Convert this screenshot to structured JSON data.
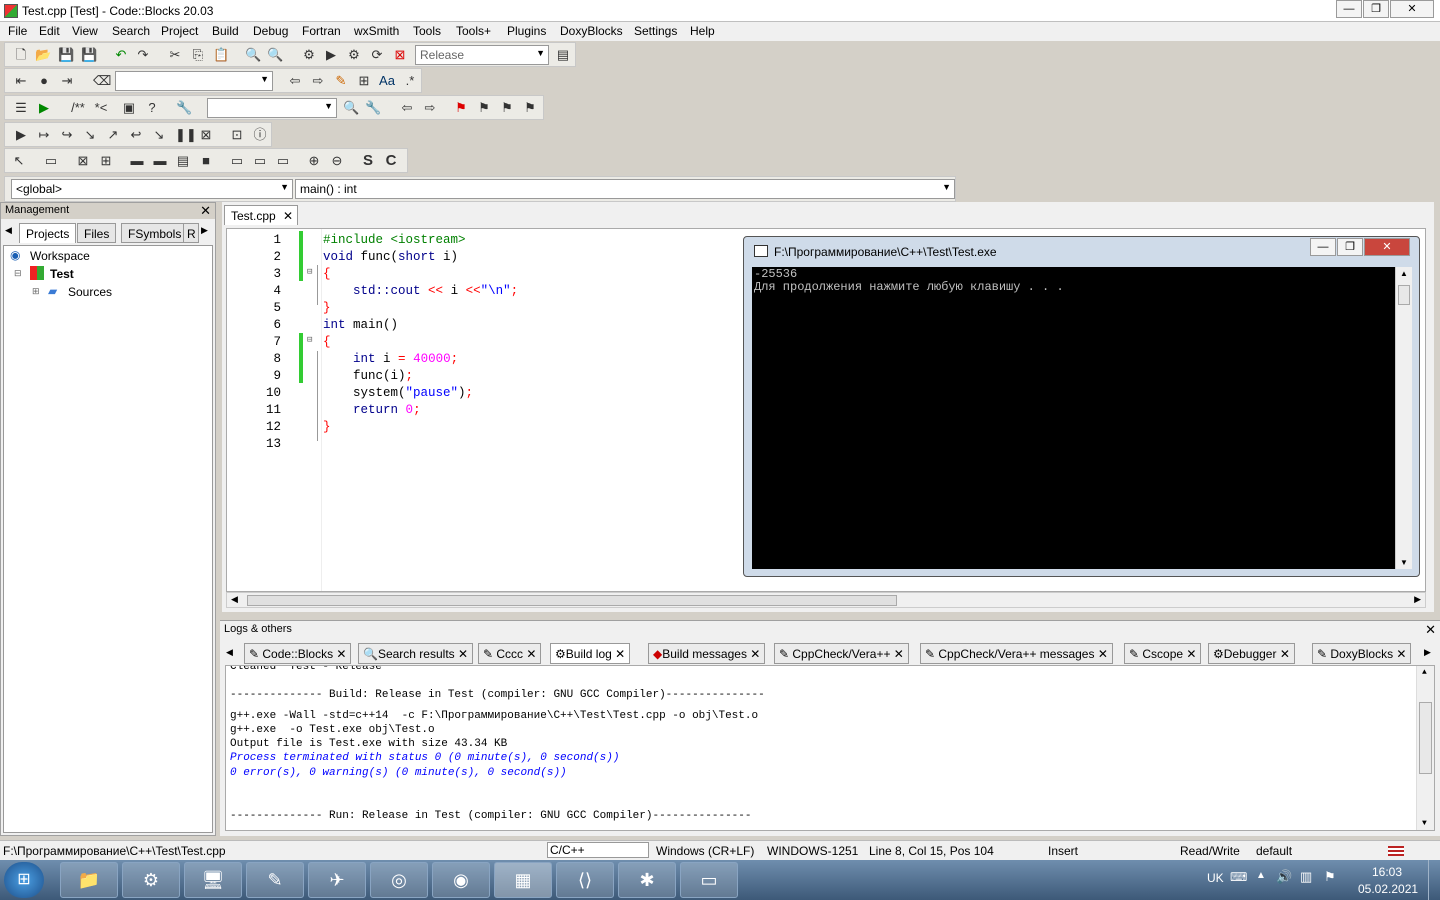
{
  "window": {
    "title": "Test.cpp [Test] - Code::Blocks 20.03"
  },
  "menu": [
    "File",
    "Edit",
    "View",
    "Search",
    "Project",
    "Build",
    "Debug",
    "Fortran",
    "wxSmith",
    "Tools",
    "Tools+",
    "Plugins",
    "DoxyBlocks",
    "Settings",
    "Help"
  ],
  "toolbar": {
    "build_target": "Release",
    "scope": "<global>",
    "function": "main() : int"
  },
  "management": {
    "title": "Management",
    "tabs": [
      "Projects",
      "Files",
      "FSymbols",
      "R"
    ],
    "tree": {
      "workspace": "Workspace",
      "project": "Test",
      "folder": "Sources"
    }
  },
  "editor": {
    "tab": "Test.cpp",
    "line_numbers": [
      "1",
      "2",
      "3",
      "4",
      "5",
      "6",
      "7",
      "8",
      "9",
      "10",
      "11",
      "12",
      "13"
    ]
  },
  "console": {
    "title": "F:\\Программирование\\C++\\Test\\Test.exe",
    "lines": [
      "-25536",
      "Для продолжения нажмите любую клавишу . . ."
    ]
  },
  "logs": {
    "title": "Logs & others",
    "tabs": [
      "Code::Blocks",
      "Search results",
      "Cccc",
      "Build log",
      "Build messages",
      "CppCheck/Vera++",
      "CppCheck/Vera++ messages",
      "Cscope",
      "Debugger",
      "DoxyBlocks"
    ],
    "lines": [
      "Cleaned \"Test - Release\"",
      "-------------- Build: Release in Test (compiler: GNU GCC Compiler)---------------",
      "g++.exe -Wall -std=c++14  -c F:\\Программирование\\C++\\Test\\Test.cpp -o obj\\Test.o",
      "g++.exe  -o Test.exe obj\\Test.o",
      "Output file is Test.exe with size 43.34 KB",
      "Process terminated with status 0 (0 minute(s), 0 second(s))",
      "0 error(s), 0 warning(s) (0 minute(s), 0 second(s))",
      "-------------- Run: Release in Test (compiler: GNU GCC Compiler)---------------"
    ]
  },
  "status": {
    "path": "F:\\Программирование\\C++\\Test\\Test.cpp",
    "lang": "C/C++",
    "eol": "Windows (CR+LF)",
    "encoding": "WINDOWS-1251",
    "position": "Line 8, Col 15, Pos 104",
    "mode": "Insert",
    "access": "Read/Write",
    "profile": "default"
  },
  "taskbar": {
    "lang": "UK",
    "time": "16:03",
    "date": "05.02.2021"
  }
}
